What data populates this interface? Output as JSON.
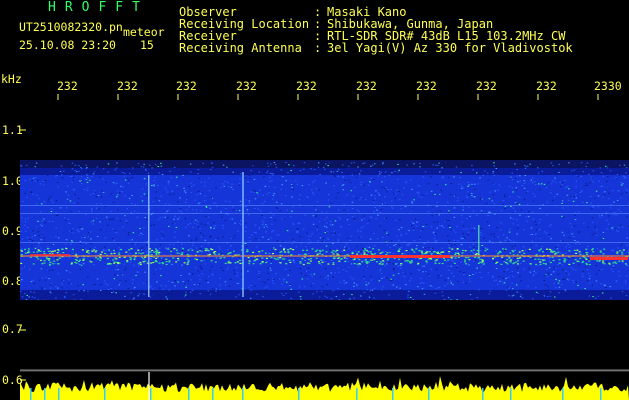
{
  "header": {
    "brand": "HROFFT",
    "filename": "UT2510082320.pn",
    "datetime": "25.10.08 23:20",
    "interval": "15",
    "mode_label": "meteor"
  },
  "info": [
    {
      "key": "Observer",
      "value": "Masaki Kano"
    },
    {
      "key": "Receiving Location",
      "value": "Shibukawa, Gunma, Japan"
    },
    {
      "key": "Receiver",
      "value": "RTL-SDR SDR# 43dB L15 103.2MHz CW"
    },
    {
      "key": "Receiving Antenna",
      "value": "3el Yagi(V) Az 330 for Vladivostok"
    }
  ],
  "separator": ":",
  "time_axis": {
    "labels": [
      "232",
      "232",
      "232",
      "232",
      "232",
      "232",
      "232",
      "232",
      "232",
      "2330"
    ]
  },
  "freq_axis": {
    "unit": "kHz",
    "labels": [
      "1.1",
      "1.0",
      "0.9",
      "0.8",
      "0.7",
      "0.6"
    ]
  },
  "colors": {
    "text": "#ffff55",
    "brand": "#33ff66",
    "band": "#1535d8",
    "band_dark": "#0a1c9a",
    "signal": "#ff3030",
    "noise_green": "#33ff88",
    "amplitude": "#ffff00",
    "tick": "#33ccff"
  }
}
